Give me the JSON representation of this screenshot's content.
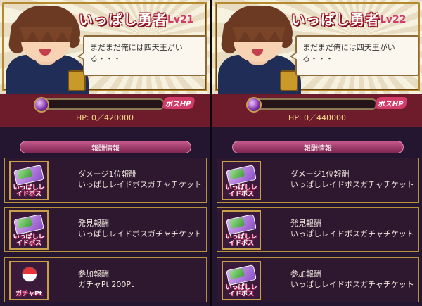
{
  "panels": [
    {
      "boss": {
        "name": "いっぱし勇者",
        "level": "Lv21",
        "speech": "まだまだ俺には四天王がいる・・・",
        "hp_tag": "ボスHP",
        "hp_text": "HP: 0／420000",
        "hp_fill": 0
      },
      "rewards_header": "報酬情報",
      "rewards": [
        {
          "title": "ダメージ1位報酬",
          "value": "いっぱしレイドボスガチャチケット",
          "thumb_label": "いっぱしレイドボス",
          "icon": "ticket-icon"
        },
        {
          "title": "発見報酬",
          "value": "いっぱしレイドボスガチャチケット",
          "thumb_label": "いっぱしレイドボス",
          "icon": "ticket-icon"
        },
        {
          "title": "参加報酬",
          "value": "ガチャPt 200Pt",
          "thumb_label": "ガチャPt",
          "icon": "gacha-ball-icon"
        }
      ]
    },
    {
      "boss": {
        "name": "いっぱし勇者",
        "level": "Lv22",
        "speech": "まだまだ俺には四天王がいる・・・",
        "hp_tag": "ボスHP",
        "hp_text": "HP: 0／440000",
        "hp_fill": 0
      },
      "rewards_header": "報酬情報",
      "rewards": [
        {
          "title": "ダメージ1位報酬",
          "value": "いっぱしレイドボスガチャチケット",
          "thumb_label": "いっぱしレイドボス",
          "icon": "ticket-icon"
        },
        {
          "title": "発見報酬",
          "value": "いっぱしレイドボスガチャチケット",
          "thumb_label": "いっぱしレイドボス",
          "icon": "ticket-icon"
        },
        {
          "title": "参加報酬",
          "value": "いっぱしレイドボスガチャチケット",
          "thumb_label": "いっぱしレイドボス",
          "icon": "ticket-icon"
        }
      ]
    }
  ],
  "colors": {
    "accent": "#d33b69",
    "hp_panel": "#6e1c2c",
    "gold_border": "#b8913d"
  }
}
